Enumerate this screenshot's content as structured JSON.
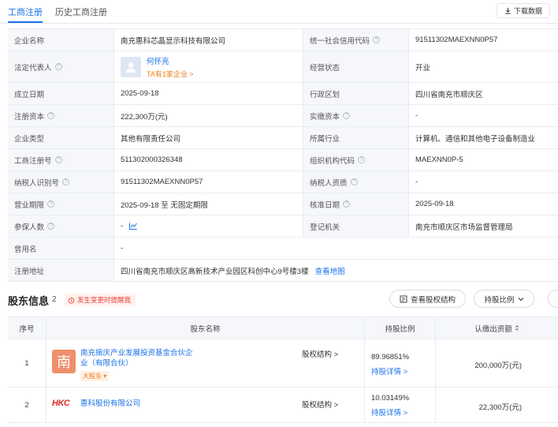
{
  "tabs": {
    "active": "工商注册",
    "history": "历史工商注册"
  },
  "download_label": "下载数据",
  "info_rows": [
    {
      "l1": "企业名称",
      "v1": "南充惠科芯晶显示科技有限公司",
      "l2": "统一社会信用代码",
      "v2": "91511302MAEXNN0P57"
    },
    {
      "l1": "法定代表人",
      "l2": "经营状态",
      "v2": "开业"
    },
    {
      "l1": "成立日期",
      "v1": "2025-09-18",
      "l2": "行政区划",
      "v2": "四川省南充市顺庆区"
    },
    {
      "l1": "注册资本",
      "v1": "222,300万(元)",
      "l2": "实缴资本",
      "v2": "-"
    },
    {
      "l1": "企业类型",
      "v1": "其他有限责任公司",
      "l2": "所属行业",
      "v2": "计算机、通信和其他电子设备制造业"
    },
    {
      "l1": "工商注册号",
      "v1": "511302000326348",
      "l2": "组织机构代码",
      "v2": "MAEXNN0P-5"
    },
    {
      "l1": "纳税人识别号",
      "v1": "91511302MAEXNN0P57",
      "l2": "纳税人资质",
      "v2": "-"
    },
    {
      "l1": "营业期限",
      "v1": "2025-09-18 至 无固定期限",
      "l2": "核准日期",
      "v2": "2025-09-18"
    },
    {
      "l1": "参保人数",
      "v1": "-",
      "l2": "登记机关",
      "v2": "南充市顺庆区市场监督管理局"
    },
    {
      "l1": "曾用名",
      "v1": "-"
    },
    {
      "l1": "注册地址",
      "v1": "四川省南充市顺庆区高新技术产业园区科创中心9号楼3楼",
      "link": "查看地图"
    }
  ],
  "legal_rep": {
    "name": "何怀亮",
    "sub": "TA有1家企业 >"
  },
  "shareholders": {
    "title": "股东信息",
    "count": "2",
    "alert": "发生变更时提醒我",
    "btn_equity": "查看股权结构",
    "btn_ratio": "持股比例",
    "columns": [
      "序号",
      "股东名称",
      "持股比例",
      "认缴出资额"
    ],
    "rows": [
      {
        "index": "1",
        "logo_text": "南",
        "name_line1": "南充振庆产业发展投资基金合伙企",
        "name_line2": "业（有限合伙）",
        "tag": "大股东",
        "equity_link": "股权结构 >",
        "ratio": "89.96851%",
        "ratio_link": "持股详情 >",
        "capital": "200,000万(元)"
      },
      {
        "index": "2",
        "logo_text": "HKC",
        "name_line1": "惠科股份有限公司",
        "equity_link": "股权结构 >",
        "ratio": "10.03149%",
        "ratio_link": "持股详情 >",
        "capital": "22,300万(元)"
      }
    ]
  },
  "colors": {
    "accent": "#1a73e8",
    "label_bg": "#f5f7fa",
    "warn": "#f07d1a",
    "alert": "#e8443a"
  }
}
